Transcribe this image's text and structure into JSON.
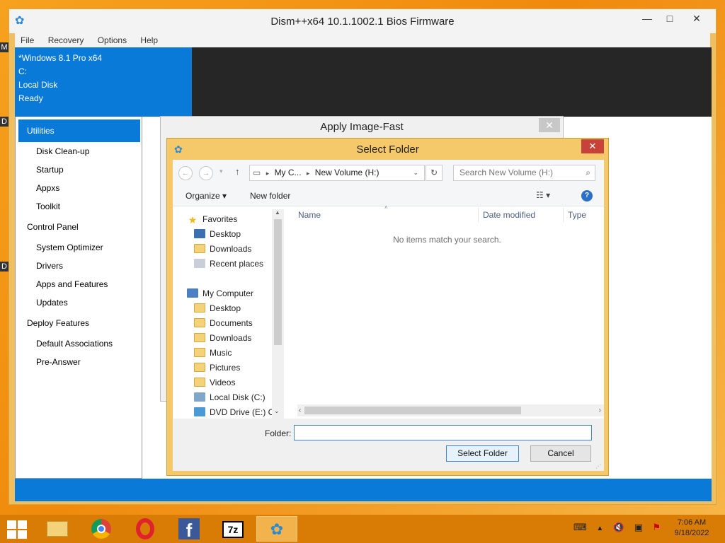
{
  "main_window": {
    "title": "Dism++x64 10.1.1002.1 Bios Firmware",
    "menu": [
      "File",
      "Recovery",
      "Options",
      "Help"
    ],
    "status": {
      "os": "*Windows 8.1 Pro x64",
      "drive": "C:",
      "volume": "Local Disk",
      "state": "Ready"
    },
    "sidebar": {
      "selected": "Utilities",
      "utilities": [
        "Disk Clean-up",
        "Startup",
        "Appxs",
        "Toolkit"
      ],
      "control_panel": "Control Panel",
      "control_items": [
        "System Optimizer",
        "Drivers",
        "Apps and Features",
        "Updates"
      ],
      "deploy": "Deploy Features",
      "deploy_items": [
        "Default Associations",
        "Pre-Answer"
      ]
    },
    "brand_color": "#0a7ad8"
  },
  "apply_dialog": {
    "title": "Apply Image-Fast"
  },
  "select_folder": {
    "title": "Select Folder",
    "address": {
      "seg1": "My C...",
      "seg2": "New Volume (H:)"
    },
    "search_placeholder": "Search New Volume (H:)",
    "organize": "Organize",
    "new_folder": "New folder",
    "nav": {
      "favorites": "Favorites",
      "fav_items": [
        "Desktop",
        "Downloads",
        "Recent places"
      ],
      "computer": "My Computer",
      "computer_items": [
        "Desktop",
        "Documents",
        "Downloads",
        "Music",
        "Pictures",
        "Videos",
        "Local Disk (C:)",
        "DVD Drive (E:) CC"
      ]
    },
    "columns": {
      "name": "Name",
      "date": "Date modified",
      "type": "Type"
    },
    "empty_message": "No items match your search.",
    "folder_label": "Folder:",
    "folder_value": "",
    "select_button": "Select Folder",
    "cancel_button": "Cancel"
  },
  "taskbar": {
    "apps": [
      "file-explorer",
      "chrome",
      "opera",
      "facebook",
      "7-zip",
      "dism"
    ],
    "sevenzip_label": "7z",
    "clock_time": "7:06 AM",
    "clock_date": "9/18/2022"
  }
}
